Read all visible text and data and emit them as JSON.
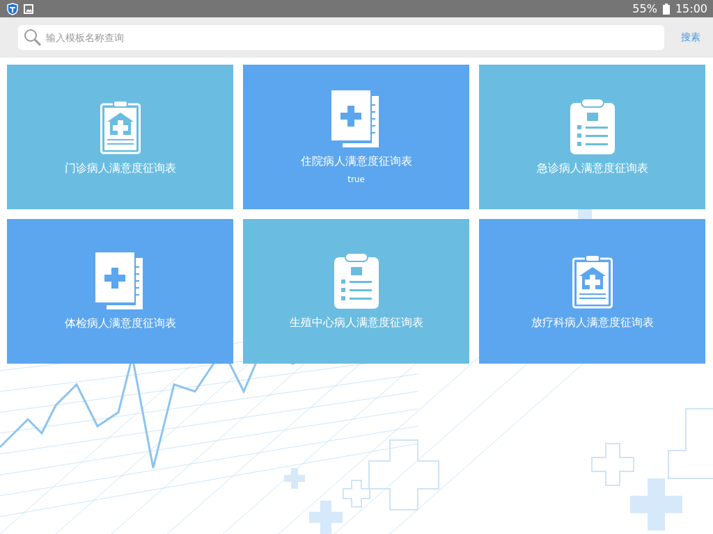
{
  "status_bar": {
    "battery": "55%",
    "time": "15:00"
  },
  "search": {
    "placeholder": "输入模板名称查询",
    "button": "搜素"
  },
  "cards": [
    {
      "title": "门诊病人满意度征询表",
      "kind": "clipboard-house",
      "color": "#6abde0"
    },
    {
      "title": "住院病人满意度征询表",
      "subtitle": "true",
      "kind": "book",
      "color": "#5ba6ef"
    },
    {
      "title": "急诊病人满意度征询表",
      "kind": "clipboard-list",
      "color": "#6abde0"
    },
    {
      "title": "体检病人满意度征询表",
      "kind": "book",
      "color": "#5ba6ef"
    },
    {
      "title": "生殖中心病人满意度征询表",
      "kind": "clipboard-list",
      "color": "#6abde0"
    },
    {
      "title": "放疗科病人满意度征询表",
      "kind": "clipboard-house",
      "color": "#5ba6ef"
    }
  ]
}
